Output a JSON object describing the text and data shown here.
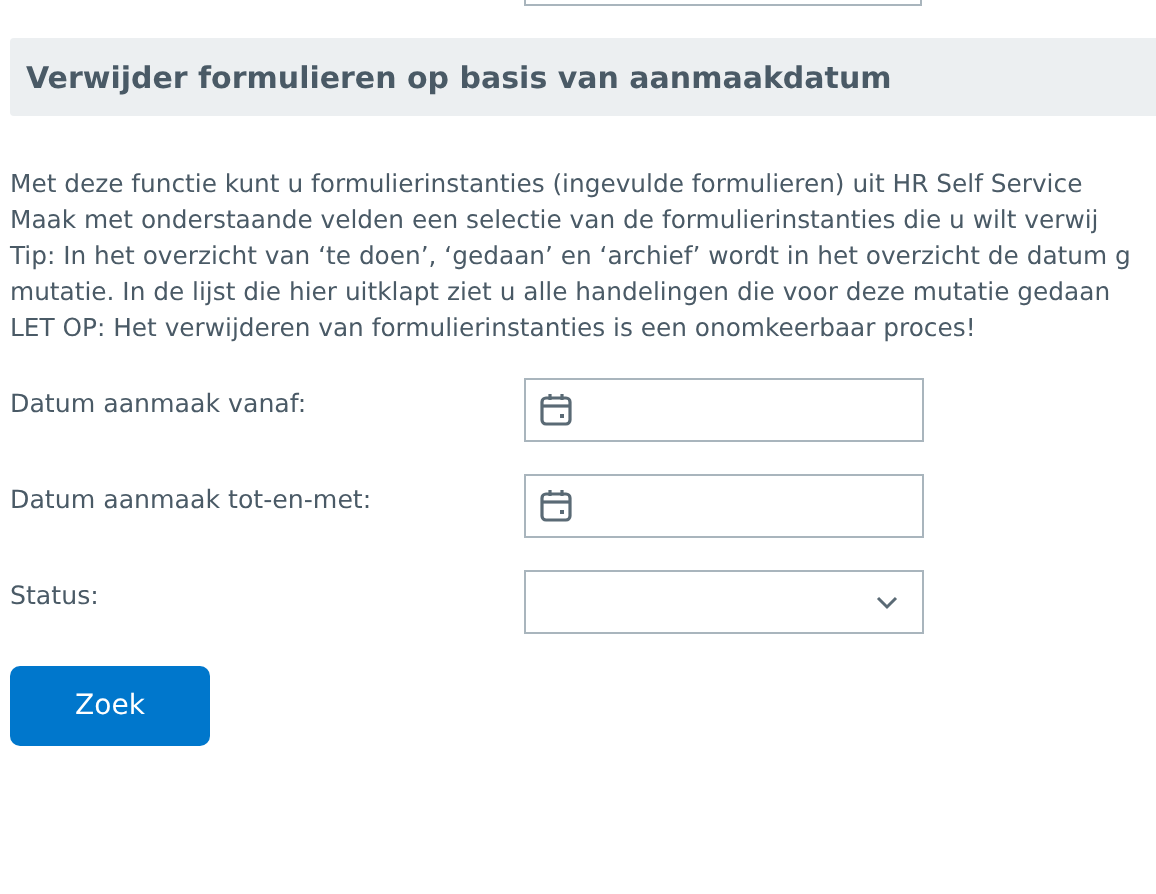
{
  "section": {
    "title": "Verwijder formulieren op basis van aanmaakdatum"
  },
  "intro_lines": [
    "Met deze functie kunt u formulierinstanties (ingevulde formulieren) uit HR Self Service",
    "Maak met onderstaande velden een selectie van de formulierinstanties die u wilt verwij",
    "Tip: In het overzicht van ‘te doen’, ‘gedaan’ en ‘archief’ wordt in het overzicht de datum g",
    "mutatie. In de lijst die hier uitklapt ziet u alle handelingen die voor deze mutatie gedaan",
    "LET OP: Het verwijderen van formulierinstanties is een onomkeerbaar proces!"
  ],
  "fields": [
    {
      "kind": "date",
      "label": "Datum aanmaak vanaf:"
    },
    {
      "kind": "date",
      "label": "Datum aanmaak tot-en-met:"
    },
    {
      "kind": "select",
      "label": "Status:"
    }
  ],
  "button": "Zoek"
}
